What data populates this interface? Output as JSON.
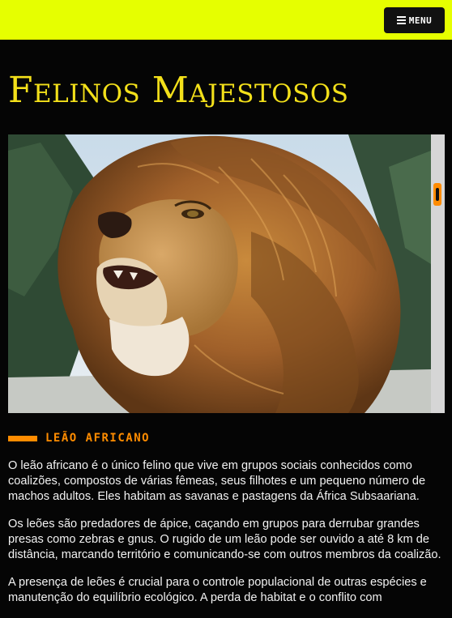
{
  "header": {
    "menu_label": "MENU",
    "accent_color": "#e6ff00"
  },
  "page": {
    "title": "Felinos Majestosos"
  },
  "hero": {
    "image_subject": "lion-portrait"
  },
  "section": {
    "label": "LEÃO AFRICANO",
    "accent_color": "#ff8c00"
  },
  "paragraphs": [
    "O leão africano é o único felino que vive em grupos sociais conhecidos como coalizões, compostos de várias fêmeas, seus filhotes e um pequeno número de machos adultos. Eles habitam as savanas e pastagens da África Subsaariana.",
    "Os leões são predadores de ápice, caçando em grupos para derrubar grandes presas como zebras e gnus. O rugido de um leão pode ser ouvido a até 8 km de distância, marcando território e comunicando-se com outros membros da coalizão.",
    "A presença de leões é crucial para o controle populacional de outras espécies e manutenção do equilíbrio ecológico. A perda de habitat e o conflito com"
  ]
}
